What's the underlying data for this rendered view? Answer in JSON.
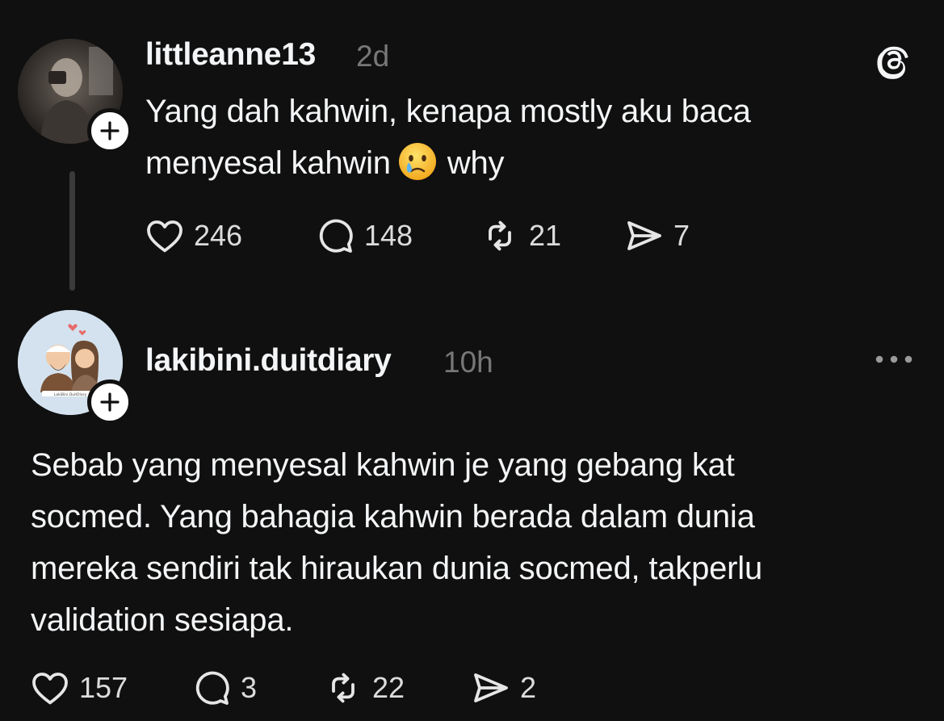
{
  "posts": [
    {
      "username": "littleanne13",
      "time": "2d",
      "lines": [
        "Yang dah kahwin, kenapa mostly aku baca",
        "menyesal kahwin",
        "why"
      ],
      "emoji": "crying-face-emoji",
      "likes": "246",
      "replies": "148",
      "reposts": "21",
      "shares": "7"
    },
    {
      "username": "lakibini.duitdiary",
      "time": "10h",
      "lines": [
        "Sebab yang menyesal kahwin je yang gebang kat",
        "socmed. Yang bahagia kahwin berada dalam dunia",
        "mereka sendiri tak hiraukan dunia socmed, takperlu",
        "validation sesiapa."
      ],
      "avatar_caption": "LakiBini.DuitDiary",
      "likes": "157",
      "replies": "3",
      "reposts": "22",
      "shares": "2"
    }
  ],
  "icons": {
    "app_logo": "threads-logo-icon",
    "more": "more-options-icon",
    "like": "heart-icon",
    "reply": "comment-icon",
    "repost": "repost-icon",
    "share": "share-icon",
    "follow": "plus-icon"
  },
  "colors": {
    "background": "#101010",
    "text": "#f3f5f7",
    "muted": "#777777",
    "thread_line": "#3a3a3a"
  }
}
